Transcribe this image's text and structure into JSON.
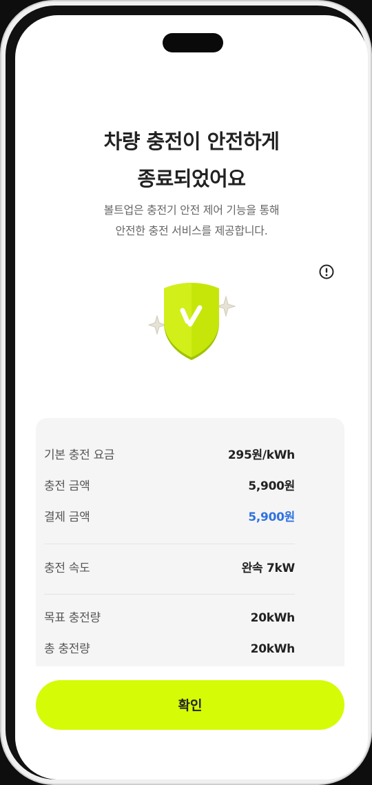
{
  "header": {
    "title_line1": "차량 충전이 안전하게",
    "title_line2": "종료되었어요",
    "subtitle_line1": "볼트업은 충전기 안전 제어 기능을 통해",
    "subtitle_line2": "안전한 충전 서비스를 제공합니다."
  },
  "icons": {
    "info": "info-circle-icon",
    "shield": "shield-check-icon"
  },
  "colors": {
    "accent": "#d6fb06",
    "shield": "#c6e60a",
    "highlight_value": "#2f73e0"
  },
  "summary": {
    "rows": [
      {
        "label": "기본 충전 요금",
        "value": "295원/kWh"
      },
      {
        "label": "충전 금액",
        "value": "5,900원"
      },
      {
        "label": "결제 금액",
        "value": "5,900원"
      },
      {
        "label": "충전 속도",
        "value": "완속 7kW"
      },
      {
        "label": "목표 충전량",
        "value": "20kWh"
      },
      {
        "label": "총 충전량",
        "value": "20kWh"
      }
    ]
  },
  "actions": {
    "confirm_label": "확인"
  }
}
